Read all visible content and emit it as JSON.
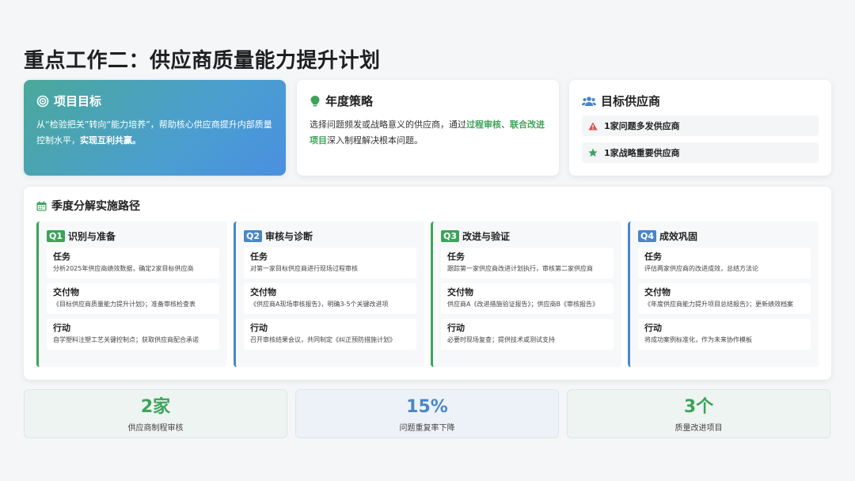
{
  "page": {
    "title": "重点工作二：供应商质量能力提升计划"
  },
  "goal": {
    "title": "项目目标",
    "text": "从“检验把关”转向“能力培养”，帮助核心供应商提升内部质量控制水平，",
    "text_strong": "实现互利共赢。",
    "icon": "target-icon"
  },
  "strategy": {
    "title": "年度策略",
    "text_a": "选择问题频发或战略意义的供应商，通过",
    "hl_1": "过程审核",
    "sep": "、",
    "hl_2": "联合改进项目",
    "text_b": "深入制程解决根本问题。",
    "icon": "lightbulb-icon"
  },
  "targets": {
    "title": "目标供应商",
    "icon": "users-icon",
    "items": [
      {
        "label": "1家问题多发供应商",
        "icon": "warning-icon",
        "color": "#d9534f"
      },
      {
        "label": "1家战略重要供应商",
        "icon": "star-icon",
        "color": "#3da35a"
      }
    ]
  },
  "quarters": {
    "title": "季度分解实施路径",
    "icon": "calendar-icon",
    "list": [
      {
        "badge": "Q1",
        "name": "识别与准备",
        "task_label": "任务",
        "task": "分析2025年供应商绩效数据，确定2家目标供应商",
        "deliv_label": "交付物",
        "deliv": "《目标供应商质量能力提升计划》；准备审核检查表",
        "action_label": "行动",
        "action": "自学塑料注塑工艺关键控制点；获取供应商配合承诺"
      },
      {
        "badge": "Q2",
        "name": "审核与诊断",
        "task_label": "任务",
        "task": "对第一家目标供应商进行现场过程审核",
        "deliv_label": "交付物",
        "deliv": "《供应商A现场审核报告》，明确3-5个关键改进项",
        "action_label": "行动",
        "action": "召开审核结果会议，共同制定《纠正预防措施计划》"
      },
      {
        "badge": "Q3",
        "name": "改进与验证",
        "task_label": "任务",
        "task": "跟踪第一家供应商改进计划执行，审核第二家供应商",
        "deliv_label": "交付物",
        "deliv": "供应商A《改进措施验证报告》；供应商B《审核报告》",
        "action_label": "行动",
        "action": "必要时现场复查；提供技术或测试支持"
      },
      {
        "badge": "Q4",
        "name": "成效巩固",
        "task_label": "任务",
        "task": "评估两家供应商的改进成效，总结方法论",
        "deliv_label": "交付物",
        "deliv": "《年度供应商能力提升项目总结报告》；更新绩效档案",
        "action_label": "行动",
        "action": "将成功案例标准化，作为未来协作模板"
      }
    ]
  },
  "stats": [
    {
      "value": "2家",
      "caption": "供应商制程审核",
      "color": "#3da35a"
    },
    {
      "value": "15%",
      "caption": "问题重复率下降",
      "color": "#4a86c8"
    },
    {
      "value": "3个",
      "caption": "质量改进项目",
      "color": "#3da35a"
    }
  ]
}
